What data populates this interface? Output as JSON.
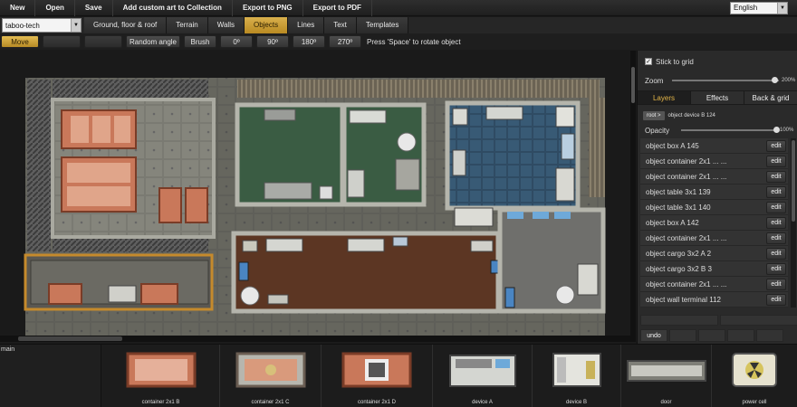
{
  "menu": [
    "New",
    "Open",
    "Save",
    "Add custom art to Collection",
    "Export to PNG",
    "Export to PDF"
  ],
  "language": "English",
  "map_name": "taboo-tech",
  "tabs": [
    {
      "label": "Ground, floor & roof",
      "active": false
    },
    {
      "label": "Terrain",
      "active": false
    },
    {
      "label": "Walls",
      "active": false
    },
    {
      "label": "Objects",
      "active": true
    },
    {
      "label": "Lines",
      "active": false
    },
    {
      "label": "Text",
      "active": false
    },
    {
      "label": "Templates",
      "active": false
    }
  ],
  "toolbar": {
    "move": "Move",
    "random_angle": "Random angle",
    "brush": "Brush",
    "angles": [
      "0º",
      "90º",
      "180º",
      "270º"
    ],
    "hint": "Press 'Space' to rotate object"
  },
  "panel": {
    "stick_to_grid": "Stick to grid",
    "zoom_label": "Zoom",
    "zoom_value": "200%",
    "zoom_level_fraction": 0.97,
    "tabs": [
      {
        "label": "Layers",
        "active": true
      },
      {
        "label": "Effects",
        "active": false
      },
      {
        "label": "Back & grid",
        "active": false
      }
    ],
    "root_button": "root >",
    "breadcrumb": "object device B 124",
    "opacity_label": "Opacity",
    "opacity_value": "100%",
    "opacity_fraction": 1.0,
    "edit_label": "edit",
    "layers": [
      "object box A 145",
      "object container 2x1 ... ...",
      "object container 2x1 ... ...",
      "object table 3x1 139",
      "object table 3x1 140",
      "object box A 142",
      "object container 2x1 ... ...",
      "object cargo 3x2 A 2",
      "object cargo 3x2 B 3",
      "object container 2x1 ... ...",
      "object wall terminal 112"
    ],
    "undo_label": "undo"
  },
  "bottom": {
    "main_label": "main",
    "assets": [
      "container 2x1 B",
      "container 2x1 C",
      "container 2x1 D",
      "device A",
      "device B",
      "door",
      "power cell"
    ]
  }
}
